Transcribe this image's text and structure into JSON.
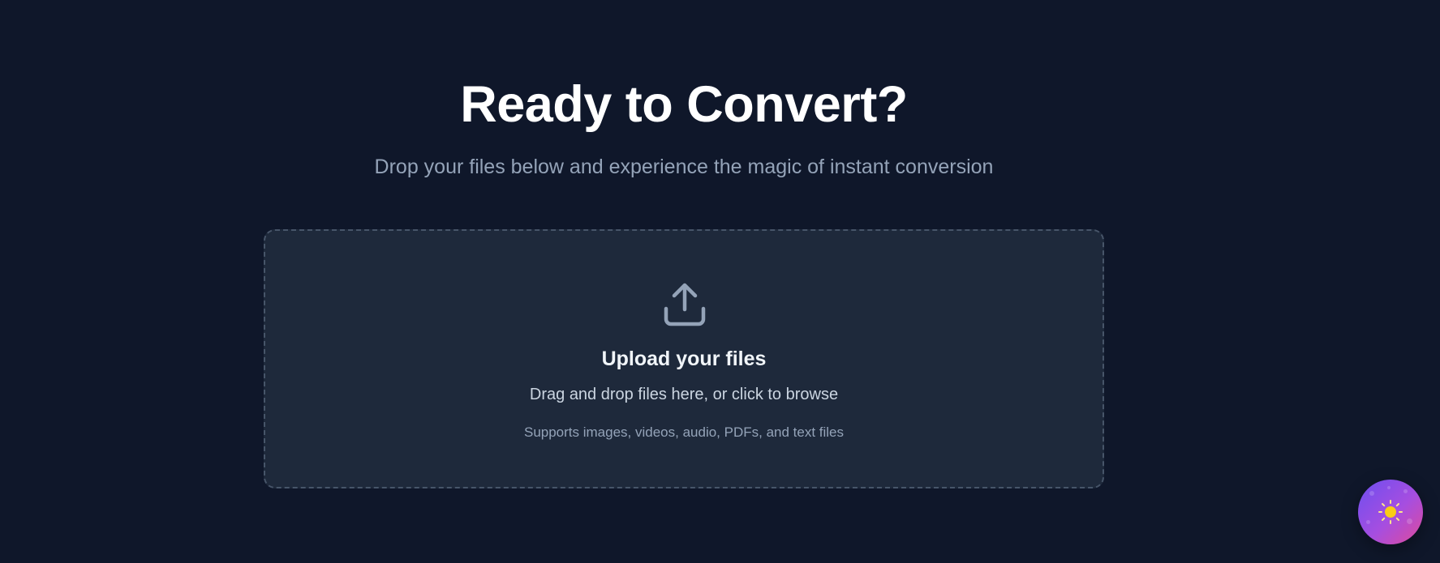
{
  "hero": {
    "title": "Ready to Convert?",
    "subtitle": "Drop your files below and experience the magic of instant conversion"
  },
  "dropzone": {
    "icon": "upload-icon",
    "title": "Upload your files",
    "instruction": "Drag and drop files here, or click to browse",
    "supported": "Supports images, videos, audio, PDFs, and text files"
  },
  "theme_toggle": {
    "icon": "sun-icon"
  },
  "colors": {
    "background": "#0f172a",
    "dropzone_bg": "#1e293b",
    "dropzone_border": "#475569",
    "title": "#ffffff",
    "muted_text": "#94a3b8",
    "toggle_gradient_start": "#6d4ff0",
    "toggle_gradient_end": "#e04a9a",
    "sun": "#facc15"
  }
}
